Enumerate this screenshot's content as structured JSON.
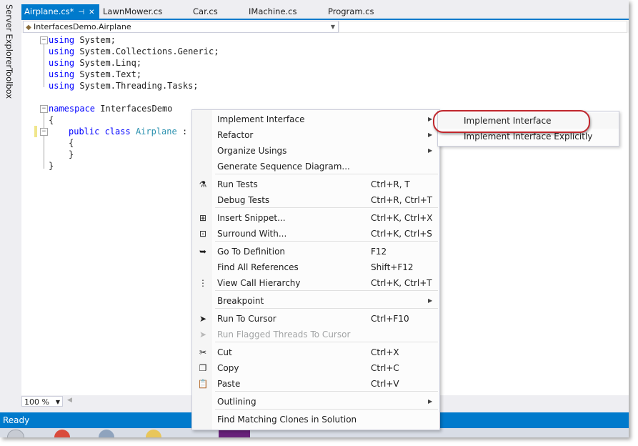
{
  "side_panels": [
    "Server Explorer",
    "Toolbox"
  ],
  "tabs": [
    {
      "label": "Airplane.cs*",
      "active": true
    },
    {
      "label": "LawnMower.cs",
      "active": false
    },
    {
      "label": "Car.cs",
      "active": false
    },
    {
      "label": "IMachine.cs",
      "active": false
    },
    {
      "label": "Program.cs",
      "active": false
    }
  ],
  "tab_pin_glyph": "⊣",
  "tab_close_glyph": "✕",
  "navbar": {
    "type_selector": "InterfacesDemo.Airplane",
    "member_selector": ""
  },
  "code": {
    "using1_kw": "using",
    "using1_ns": "System;",
    "using2_kw": "using",
    "using2_ns": "System.Collections.Generic;",
    "using3_kw": "using",
    "using3_ns": "System.Linq;",
    "using4_kw": "using",
    "using4_ns": "System.Text;",
    "using5_kw": "using",
    "using5_ns": "System.Threading.Tasks;",
    "ns_kw": "namespace",
    "ns_name": "InterfacesDemo",
    "brace_open": "{",
    "class_mods": "public class",
    "class_name": "Airplane",
    "class_colon": ":",
    "inner_open": "{",
    "inner_close": "}",
    "brace_close": "}"
  },
  "zoom": "100 %",
  "status": "Ready",
  "context_menu": [
    {
      "label": "Implement Interface",
      "shortcut": "",
      "submenu": true,
      "icon": ""
    },
    {
      "label": "Refactor",
      "shortcut": "",
      "submenu": true,
      "icon": ""
    },
    {
      "label": "Organize Usings",
      "shortcut": "",
      "submenu": true,
      "icon": ""
    },
    {
      "label": "Generate Sequence Diagram...",
      "shortcut": "",
      "submenu": false,
      "icon": ""
    },
    {
      "label": "Run Tests",
      "shortcut": "Ctrl+R, T",
      "submenu": false,
      "icon": "flask-icon"
    },
    {
      "label": "Debug Tests",
      "shortcut": "Ctrl+R, Ctrl+T",
      "submenu": false,
      "icon": ""
    },
    {
      "label": "Insert Snippet...",
      "shortcut": "Ctrl+K, Ctrl+X",
      "submenu": false,
      "icon": "snippet-icon"
    },
    {
      "label": "Surround With...",
      "shortcut": "Ctrl+K, Ctrl+S",
      "submenu": false,
      "icon": "surround-icon"
    },
    {
      "label": "Go To Definition",
      "shortcut": "F12",
      "submenu": false,
      "icon": "go-to-definition-icon"
    },
    {
      "label": "Find All References",
      "shortcut": "Shift+F12",
      "submenu": false,
      "icon": ""
    },
    {
      "label": "View Call Hierarchy",
      "shortcut": "Ctrl+K, Ctrl+T",
      "submenu": false,
      "icon": "call-hierarchy-icon"
    },
    {
      "label": "Breakpoint",
      "shortcut": "",
      "submenu": true,
      "icon": ""
    },
    {
      "label": "Run To Cursor",
      "shortcut": "Ctrl+F10",
      "submenu": false,
      "icon": "cursor-icon"
    },
    {
      "label": "Run Flagged Threads To Cursor",
      "shortcut": "",
      "submenu": false,
      "icon": "cursor-icon",
      "disabled": true
    },
    {
      "label": "Cut",
      "shortcut": "Ctrl+X",
      "submenu": false,
      "icon": "scissors-icon"
    },
    {
      "label": "Copy",
      "shortcut": "Ctrl+C",
      "submenu": false,
      "icon": "copy-icon"
    },
    {
      "label": "Paste",
      "shortcut": "Ctrl+V",
      "submenu": false,
      "icon": "paste-icon"
    },
    {
      "label": "Outlining",
      "shortcut": "",
      "submenu": true,
      "icon": ""
    },
    {
      "label": "Find Matching Clones in Solution",
      "shortcut": "",
      "submenu": false,
      "icon": ""
    }
  ],
  "submenu": [
    {
      "label": "Implement Interface"
    },
    {
      "label": "Implement Interface Explicitly"
    }
  ],
  "colors": {
    "accent": "#007acc",
    "callout": "#c0262c",
    "keyword": "#0000ff",
    "type": "#2b91af"
  }
}
